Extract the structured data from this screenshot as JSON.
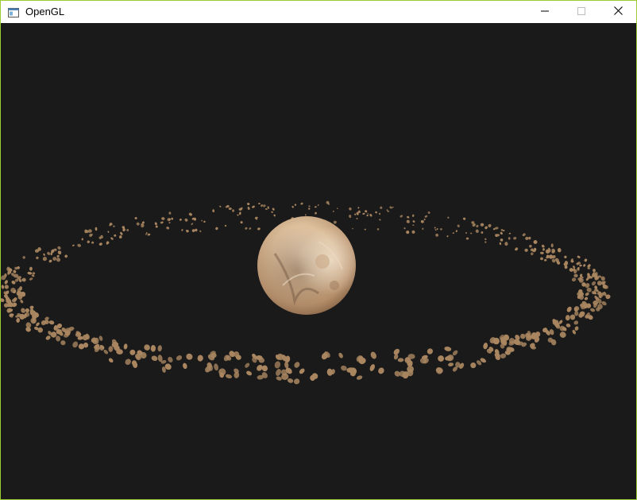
{
  "window": {
    "title": "OpenGL",
    "icon": "app-window-icon",
    "controls": {
      "minimize_icon": "minimize-icon",
      "maximize_icon": "maximize-icon",
      "close_icon": "close-icon"
    }
  },
  "scene": {
    "background_color": "#1a1a1a",
    "planet_color": "#d9b894",
    "asteroid_color": "#a98660"
  }
}
